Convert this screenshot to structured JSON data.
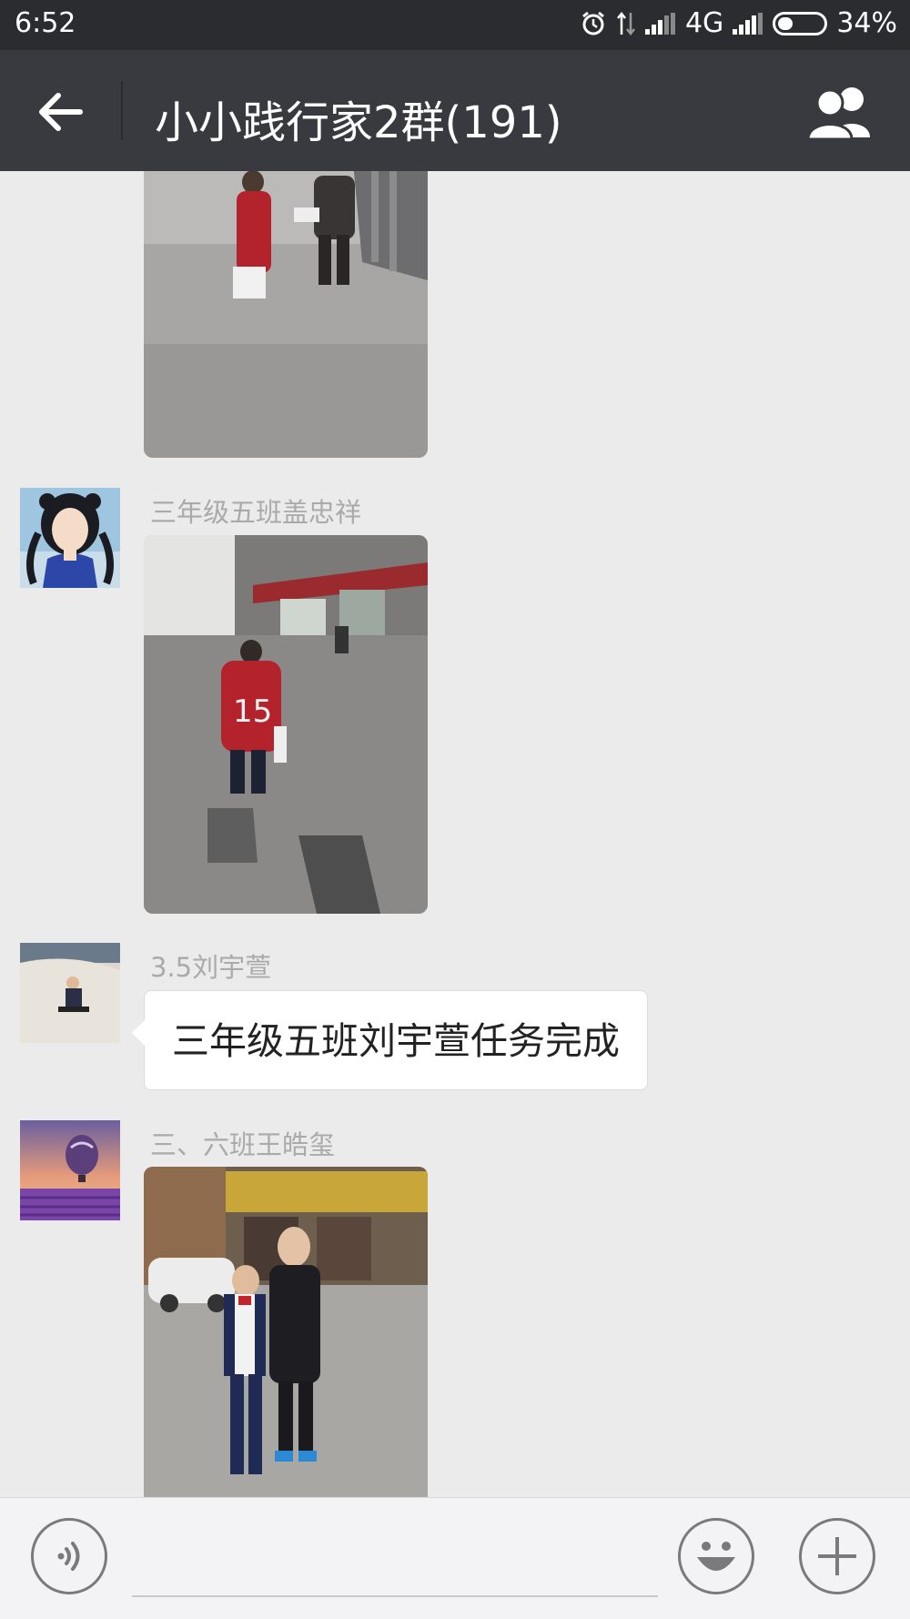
{
  "status_bar": {
    "time": "6:52",
    "network": "4G",
    "battery": "34%",
    "battery_level": 0.34
  },
  "header": {
    "title": "小小践行家2群(191)",
    "back_icon": "back-arrow-icon",
    "members_icon": "group-members-icon"
  },
  "messages": [
    {
      "type": "image",
      "sender": "",
      "description_icon": "photo-girl-red-coat-street"
    },
    {
      "type": "image",
      "sender": "三年级五班盖忠祥",
      "avatar": "anime-girl-avatar"
    },
    {
      "type": "text",
      "sender": "3.5刘宇萱",
      "text": "三年级五班刘宇萱任务完成",
      "avatar": "child-in-snow-avatar"
    },
    {
      "type": "image",
      "sender": "三、六班王皓玺",
      "avatar": "hot-air-balloon-avatar"
    }
  ],
  "input_bar": {
    "voice_icon": "voice-icon",
    "emoji_icon": "emoji-icon",
    "plus_icon": "plus-icon"
  },
  "colors": {
    "status_bg": "#2b2c30",
    "header_bg": "#393a3f",
    "chat_bg": "#ebebeb",
    "bubble_bg": "#ffffff"
  }
}
